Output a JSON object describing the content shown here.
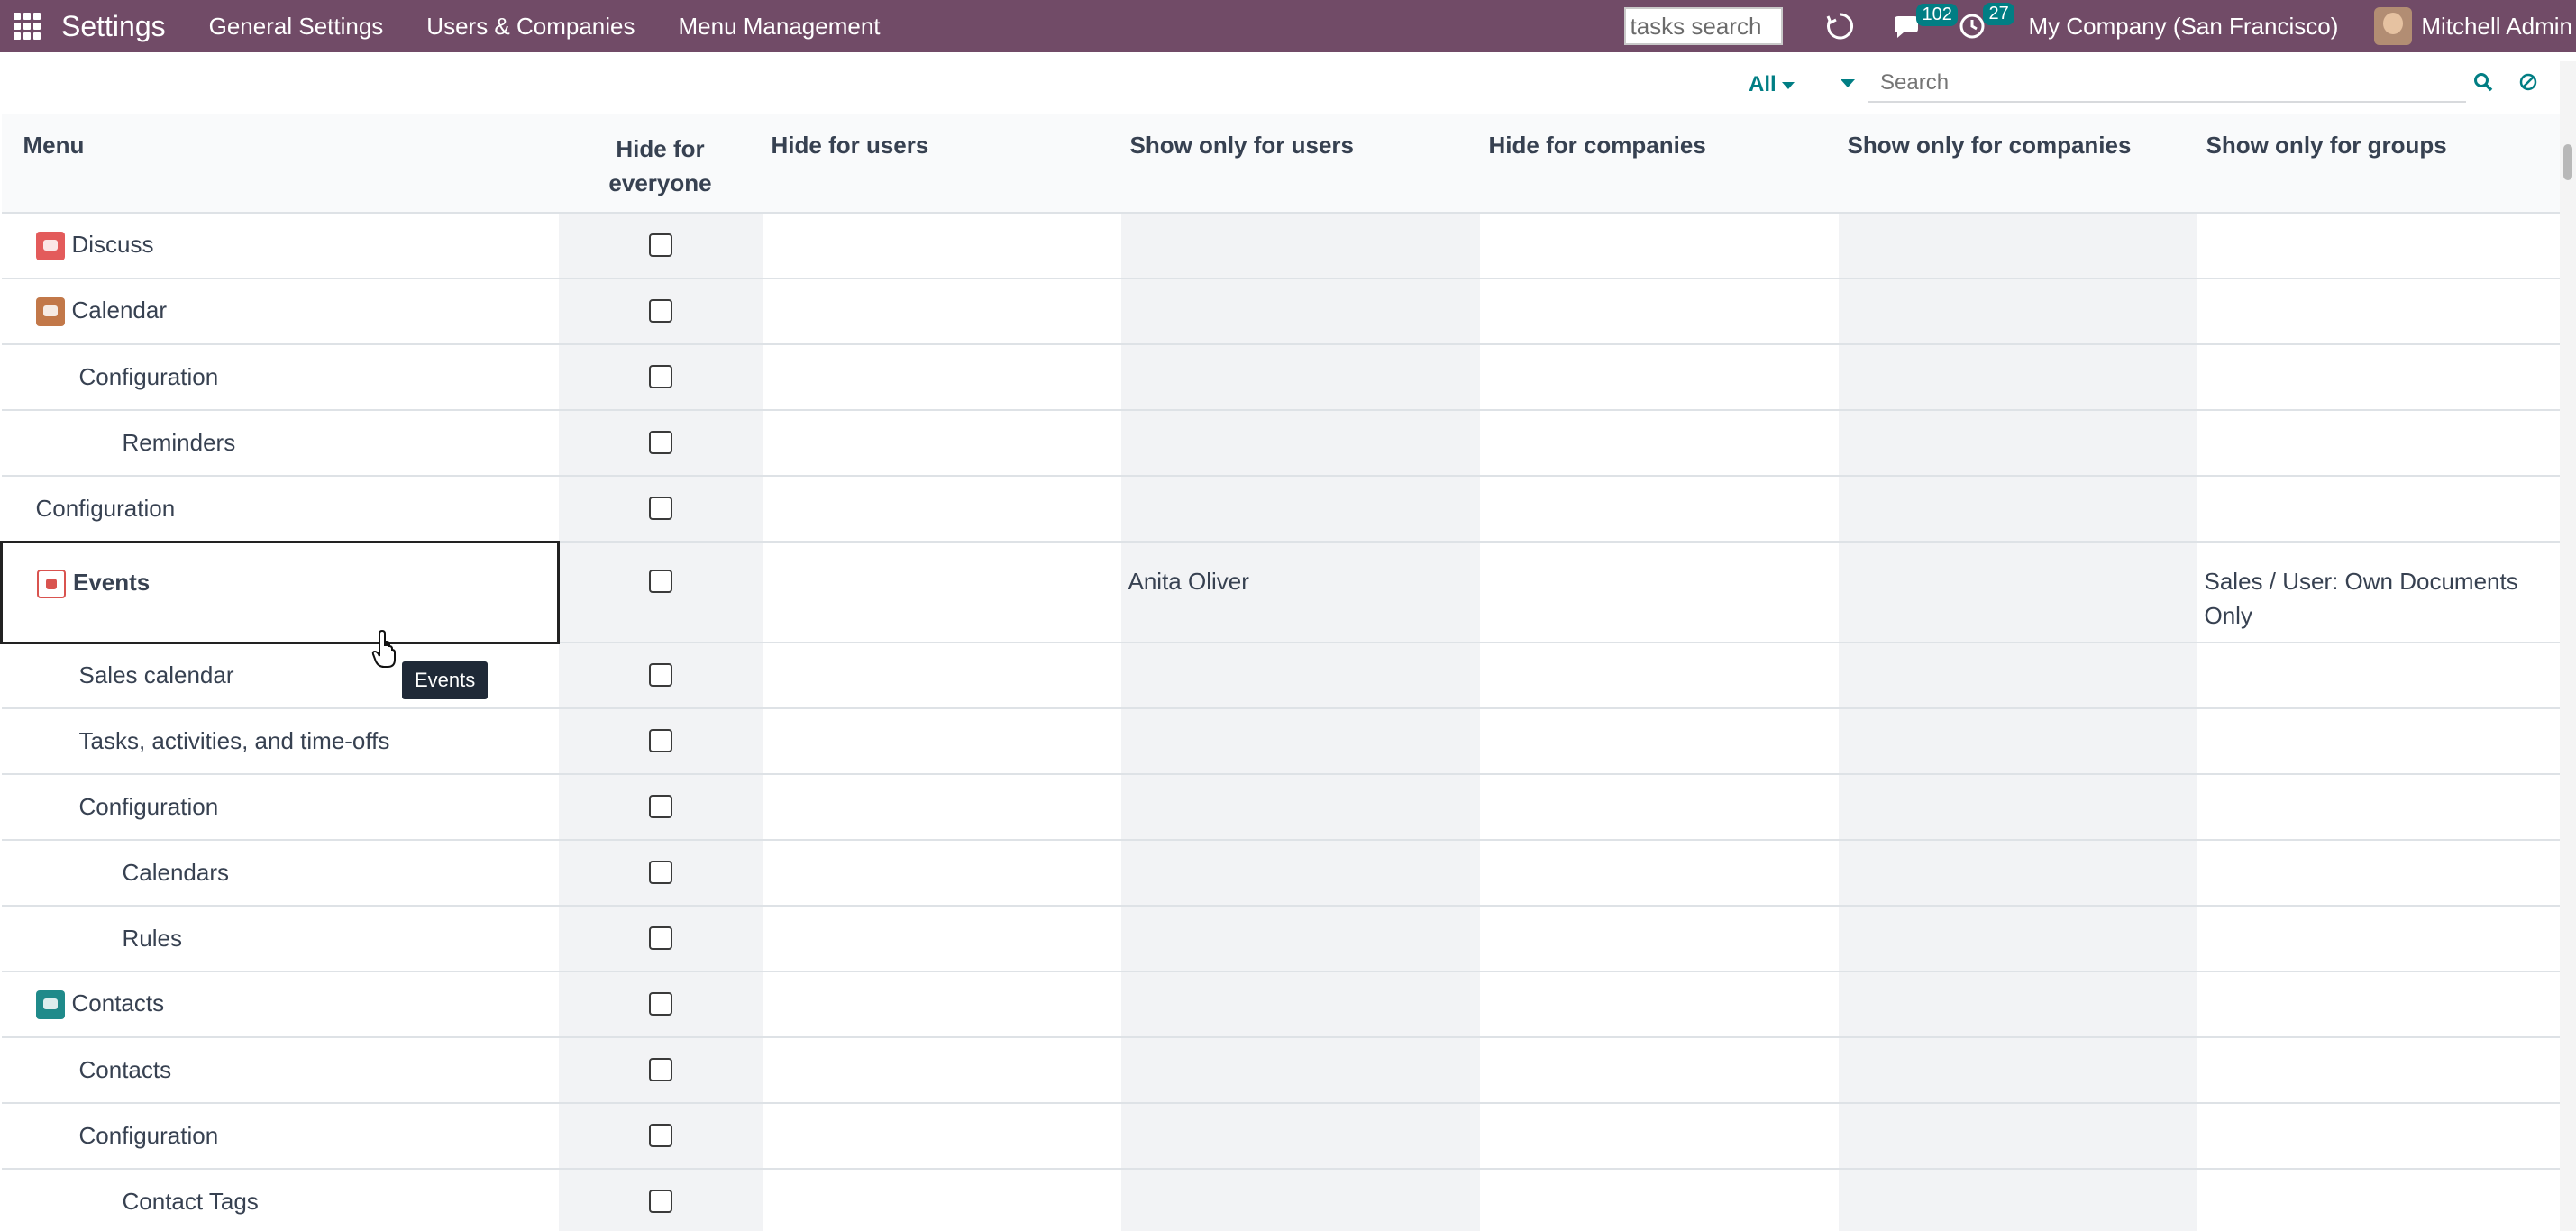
{
  "navbar": {
    "brand": "Settings",
    "menu": [
      "General Settings",
      "Users & Companies",
      "Menu Management"
    ],
    "tasks_search_value": "tasks search",
    "messages_count": "102",
    "activities_count": "27",
    "company": "My Company (San Francisco)",
    "user": "Mitchell Admin"
  },
  "control_panel": {
    "filter_label": "All",
    "search_placeholder": "Search"
  },
  "table": {
    "headers": {
      "menu": "Menu",
      "hide_everyone": "Hide for everyone",
      "hide_users": "Hide for users",
      "show_users": "Show only for users",
      "hide_companies": "Hide for companies",
      "show_companies": "Show only for companies",
      "show_groups": "Show only for groups"
    },
    "rows": [
      {
        "label": "Discuss",
        "level": 0,
        "icon": "discuss-icon",
        "checked": false,
        "show_users": "",
        "show_groups": ""
      },
      {
        "label": "Calendar",
        "level": 0,
        "icon": "calendar-icon",
        "checked": false,
        "show_users": "",
        "show_groups": ""
      },
      {
        "label": "Configuration",
        "level": 1,
        "icon": "",
        "checked": false,
        "show_users": "",
        "show_groups": ""
      },
      {
        "label": "Reminders",
        "level": 2,
        "icon": "",
        "checked": false,
        "show_users": "",
        "show_groups": ""
      },
      {
        "label": "Configuration",
        "level": 0,
        "icon": "",
        "checked": false,
        "show_users": "",
        "show_groups": ""
      },
      {
        "label": "Events",
        "level": 0,
        "icon": "events-icon",
        "checked": false,
        "show_users": "Anita Oliver",
        "show_groups": "Sales / User: Own Documents Only"
      },
      {
        "label": "Sales calendar",
        "level": 1,
        "icon": "",
        "checked": false,
        "show_users": "",
        "show_groups": ""
      },
      {
        "label": "Tasks, activities, and time-offs",
        "level": 1,
        "icon": "",
        "checked": false,
        "show_users": "",
        "show_groups": ""
      },
      {
        "label": "Configuration",
        "level": 1,
        "icon": "",
        "checked": false,
        "show_users": "",
        "show_groups": ""
      },
      {
        "label": "Calendars",
        "level": 2,
        "icon": "",
        "checked": false,
        "show_users": "",
        "show_groups": ""
      },
      {
        "label": "Rules",
        "level": 2,
        "icon": "",
        "checked": false,
        "show_users": "",
        "show_groups": ""
      },
      {
        "label": "Contacts",
        "level": 0,
        "icon": "contacts-icon",
        "checked": false,
        "show_users": "",
        "show_groups": ""
      },
      {
        "label": "Contacts",
        "level": 1,
        "icon": "",
        "checked": false,
        "show_users": "",
        "show_groups": ""
      },
      {
        "label": "Configuration",
        "level": 1,
        "icon": "",
        "checked": false,
        "show_users": "",
        "show_groups": ""
      },
      {
        "label": "Contact Tags",
        "level": 2,
        "icon": "",
        "checked": false,
        "show_users": "",
        "show_groups": ""
      }
    ]
  },
  "tooltip": "Events",
  "colors": {
    "navbar": "#714b67",
    "accent": "#017e84"
  }
}
